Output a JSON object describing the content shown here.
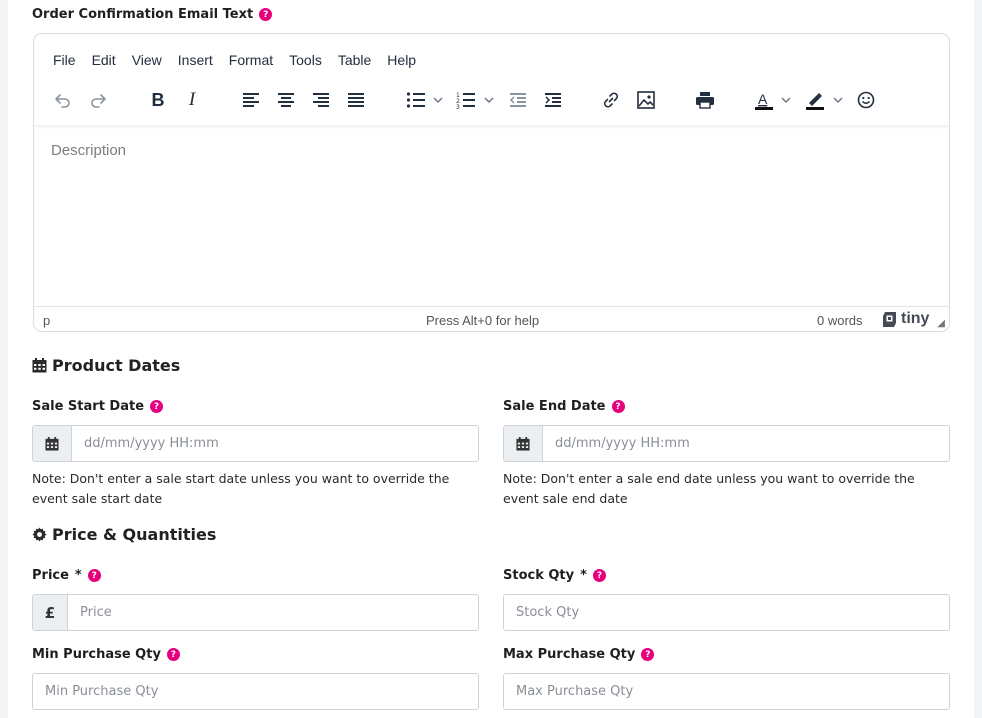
{
  "order_email": {
    "label": "Order Confirmation Email Text",
    "help": "?"
  },
  "editor": {
    "menu": [
      "File",
      "Edit",
      "View",
      "Insert",
      "Format",
      "Tools",
      "Table",
      "Help"
    ],
    "placeholder": "Description",
    "status_path": "p",
    "status_help": "Press Alt+0 for help",
    "word_count": "0 words",
    "brand": "tiny",
    "toolbar_icons": [
      "undo-icon",
      "redo-icon",
      "bold-icon",
      "italic-icon",
      "align-left-icon",
      "align-center-icon",
      "align-right-icon",
      "justify-icon",
      "bullet-list-icon",
      "numbered-list-icon",
      "outdent-icon",
      "indent-icon",
      "link-icon",
      "image-icon",
      "print-icon",
      "text-color-icon",
      "highlight-icon",
      "emoticon-icon"
    ],
    "bold_glyph": "B",
    "italic_glyph": "I",
    "text_color_glyph": "A"
  },
  "product_dates": {
    "title": "Product Dates",
    "start": {
      "label": "Sale Start Date",
      "placeholder": "dd/mm/yyyy HH:mm",
      "note": "Note: Don't enter a sale start date unless you want to override the event sale start date"
    },
    "end": {
      "label": "Sale End Date",
      "placeholder": "dd/mm/yyyy HH:mm",
      "note": "Note: Don't enter a sale end date unless you want to override the event sale end date"
    }
  },
  "price_quantities": {
    "title": "Price & Quantities",
    "price": {
      "label": "Price",
      "required": "*",
      "currency": "£",
      "placeholder": "Price"
    },
    "stock": {
      "label": "Stock Qty",
      "required": "*",
      "placeholder": "Stock Qty"
    },
    "min": {
      "label": "Min Purchase Qty",
      "placeholder": "Min Purchase Qty"
    },
    "max": {
      "label": "Max Purchase Qty",
      "placeholder": "Max Purchase Qty"
    }
  },
  "colors": {
    "help_badge": "#e6007e",
    "text": "#222222",
    "border": "#cfd3d8"
  }
}
